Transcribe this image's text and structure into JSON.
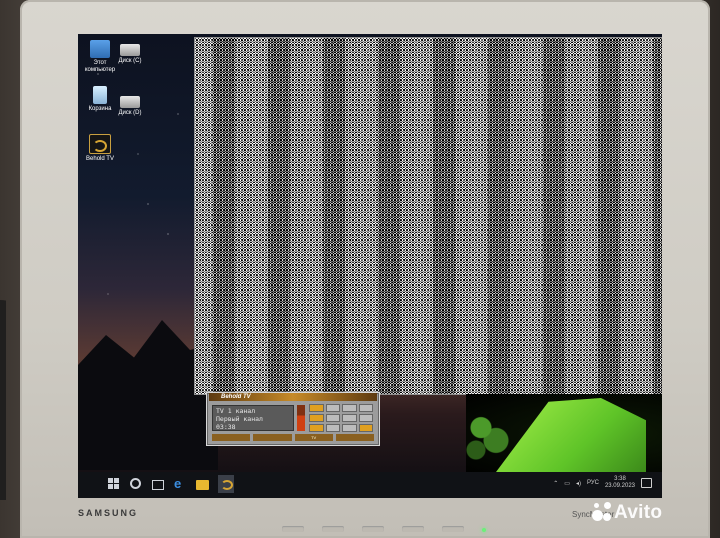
{
  "desktop": {
    "icons": [
      {
        "label": "Этот компьютер"
      },
      {
        "label": "Диск (C)"
      },
      {
        "label": "Корзина"
      },
      {
        "label": "Диск (D)"
      },
      {
        "label": "Behold TV"
      }
    ]
  },
  "tv_panel": {
    "title": "Behold TV",
    "lcd_line1": "TV  1 канал",
    "lcd_line2": "Первый канал",
    "lcd_line3": "03:38",
    "bottom_buttons": [
      "",
      "",
      "TV",
      ""
    ]
  },
  "taskbar": {
    "icons": [
      "windows-start-icon",
      "search-icon",
      "task-view-icon",
      "edge-icon",
      "file-explorer-icon",
      "behold-tv-icon"
    ],
    "tray_lang": "РУС",
    "clock_time": "3:38",
    "clock_date": "23.09.2023"
  },
  "monitor": {
    "brand": "SAMSUNG",
    "model": "SyncMaster"
  },
  "watermark": "Avito"
}
